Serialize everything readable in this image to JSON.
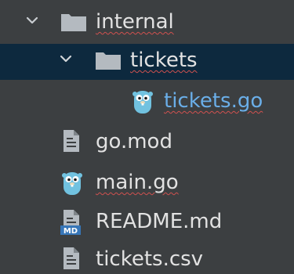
{
  "project_tree": {
    "items": [
      {
        "label": "internal",
        "kind": "folder",
        "icon": "folder-icon",
        "expanded": true,
        "spell_error": true
      },
      {
        "label": "tickets",
        "kind": "folder",
        "icon": "folder-icon",
        "expanded": true,
        "selected": true,
        "spell_error": true
      },
      {
        "label": "tickets.go",
        "kind": "go-file",
        "icon": "gopher-icon",
        "spell_error": true,
        "link": true
      },
      {
        "label": "go.mod",
        "kind": "file",
        "icon": "text-file-icon"
      },
      {
        "label": "main.go",
        "kind": "go-file",
        "icon": "gopher-icon",
        "spell_error": true
      },
      {
        "label": "README.md",
        "kind": "markdown-file",
        "icon": "markdown-file-icon",
        "badge": "MD"
      },
      {
        "label": "tickets.csv",
        "kind": "file",
        "icon": "text-file-icon"
      }
    ]
  },
  "colors": {
    "background": "#3c3f41",
    "selection": "#0d293e",
    "text": "#e2e2e2",
    "link_text": "#6aaee8",
    "folder_icon": "#b4bac0",
    "gopher": "#71c2e0",
    "spell_error_underline": "#d0514f",
    "md_badge": "#3776b8"
  }
}
